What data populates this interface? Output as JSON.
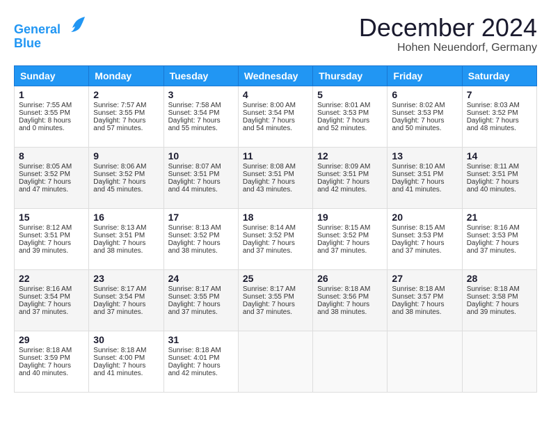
{
  "logo": {
    "line1": "General",
    "line2": "Blue"
  },
  "title": "December 2024",
  "location": "Hohen Neuendorf, Germany",
  "days_of_week": [
    "Sunday",
    "Monday",
    "Tuesday",
    "Wednesday",
    "Thursday",
    "Friday",
    "Saturday"
  ],
  "weeks": [
    [
      {
        "day": "1",
        "sunrise": "7:55 AM",
        "sunset": "3:55 PM",
        "daylight": "8 hours and 0 minutes."
      },
      {
        "day": "2",
        "sunrise": "7:57 AM",
        "sunset": "3:55 PM",
        "daylight": "7 hours and 57 minutes."
      },
      {
        "day": "3",
        "sunrise": "7:58 AM",
        "sunset": "3:54 PM",
        "daylight": "7 hours and 55 minutes."
      },
      {
        "day": "4",
        "sunrise": "8:00 AM",
        "sunset": "3:54 PM",
        "daylight": "7 hours and 54 minutes."
      },
      {
        "day": "5",
        "sunrise": "8:01 AM",
        "sunset": "3:53 PM",
        "daylight": "7 hours and 52 minutes."
      },
      {
        "day": "6",
        "sunrise": "8:02 AM",
        "sunset": "3:53 PM",
        "daylight": "7 hours and 50 minutes."
      },
      {
        "day": "7",
        "sunrise": "8:03 AM",
        "sunset": "3:52 PM",
        "daylight": "7 hours and 48 minutes."
      }
    ],
    [
      {
        "day": "8",
        "sunrise": "8:05 AM",
        "sunset": "3:52 PM",
        "daylight": "7 hours and 47 minutes."
      },
      {
        "day": "9",
        "sunrise": "8:06 AM",
        "sunset": "3:52 PM",
        "daylight": "7 hours and 45 minutes."
      },
      {
        "day": "10",
        "sunrise": "8:07 AM",
        "sunset": "3:51 PM",
        "daylight": "7 hours and 44 minutes."
      },
      {
        "day": "11",
        "sunrise": "8:08 AM",
        "sunset": "3:51 PM",
        "daylight": "7 hours and 43 minutes."
      },
      {
        "day": "12",
        "sunrise": "8:09 AM",
        "sunset": "3:51 PM",
        "daylight": "7 hours and 42 minutes."
      },
      {
        "day": "13",
        "sunrise": "8:10 AM",
        "sunset": "3:51 PM",
        "daylight": "7 hours and 41 minutes."
      },
      {
        "day": "14",
        "sunrise": "8:11 AM",
        "sunset": "3:51 PM",
        "daylight": "7 hours and 40 minutes."
      }
    ],
    [
      {
        "day": "15",
        "sunrise": "8:12 AM",
        "sunset": "3:51 PM",
        "daylight": "7 hours and 39 minutes."
      },
      {
        "day": "16",
        "sunrise": "8:13 AM",
        "sunset": "3:51 PM",
        "daylight": "7 hours and 38 minutes."
      },
      {
        "day": "17",
        "sunrise": "8:13 AM",
        "sunset": "3:52 PM",
        "daylight": "7 hours and 38 minutes."
      },
      {
        "day": "18",
        "sunrise": "8:14 AM",
        "sunset": "3:52 PM",
        "daylight": "7 hours and 37 minutes."
      },
      {
        "day": "19",
        "sunrise": "8:15 AM",
        "sunset": "3:52 PM",
        "daylight": "7 hours and 37 minutes."
      },
      {
        "day": "20",
        "sunrise": "8:15 AM",
        "sunset": "3:53 PM",
        "daylight": "7 hours and 37 minutes."
      },
      {
        "day": "21",
        "sunrise": "8:16 AM",
        "sunset": "3:53 PM",
        "daylight": "7 hours and 37 minutes."
      }
    ],
    [
      {
        "day": "22",
        "sunrise": "8:16 AM",
        "sunset": "3:54 PM",
        "daylight": "7 hours and 37 minutes."
      },
      {
        "day": "23",
        "sunrise": "8:17 AM",
        "sunset": "3:54 PM",
        "daylight": "7 hours and 37 minutes."
      },
      {
        "day": "24",
        "sunrise": "8:17 AM",
        "sunset": "3:55 PM",
        "daylight": "7 hours and 37 minutes."
      },
      {
        "day": "25",
        "sunrise": "8:17 AM",
        "sunset": "3:55 PM",
        "daylight": "7 hours and 37 minutes."
      },
      {
        "day": "26",
        "sunrise": "8:18 AM",
        "sunset": "3:56 PM",
        "daylight": "7 hours and 38 minutes."
      },
      {
        "day": "27",
        "sunrise": "8:18 AM",
        "sunset": "3:57 PM",
        "daylight": "7 hours and 38 minutes."
      },
      {
        "day": "28",
        "sunrise": "8:18 AM",
        "sunset": "3:58 PM",
        "daylight": "7 hours and 39 minutes."
      }
    ],
    [
      {
        "day": "29",
        "sunrise": "8:18 AM",
        "sunset": "3:59 PM",
        "daylight": "7 hours and 40 minutes."
      },
      {
        "day": "30",
        "sunrise": "8:18 AM",
        "sunset": "4:00 PM",
        "daylight": "7 hours and 41 minutes."
      },
      {
        "day": "31",
        "sunrise": "8:18 AM",
        "sunset": "4:01 PM",
        "daylight": "7 hours and 42 minutes."
      },
      null,
      null,
      null,
      null
    ]
  ]
}
